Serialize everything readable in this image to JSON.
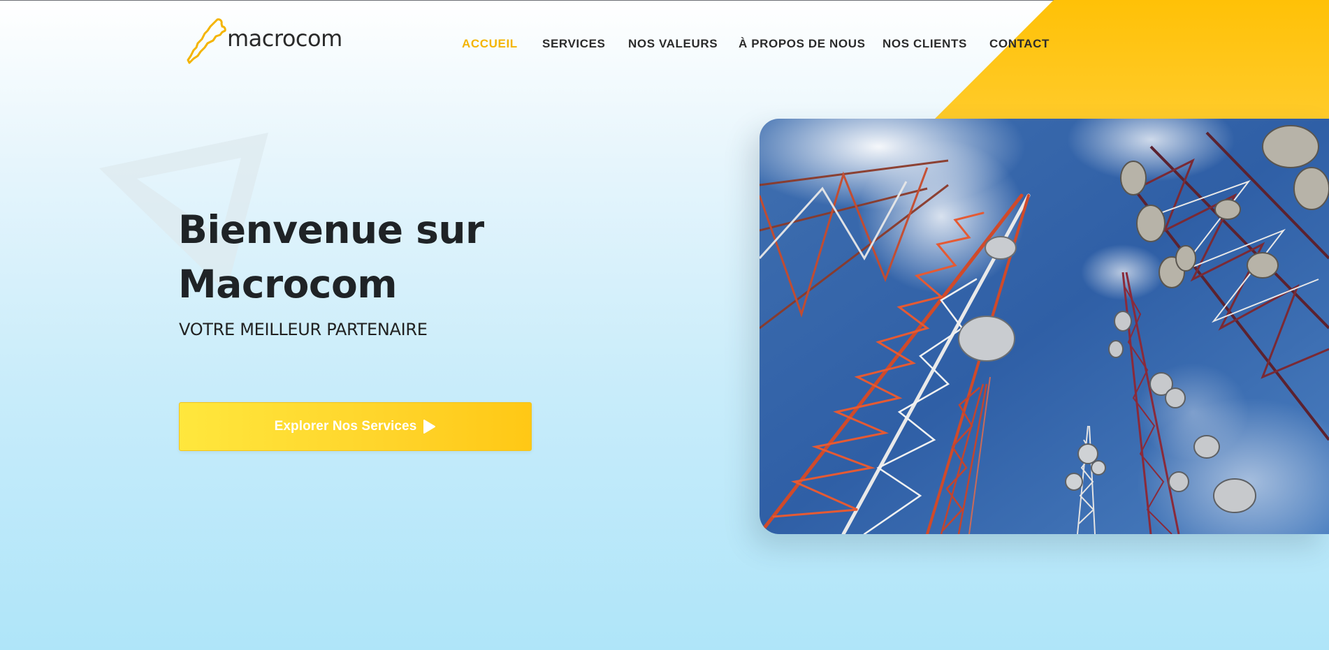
{
  "brand": {
    "name": "macrocom",
    "accent": "#f4b400",
    "cta_color": "#ffd42a"
  },
  "nav": {
    "items": [
      {
        "label": "ACCUEIL",
        "active": true
      },
      {
        "label": "SERVICES",
        "active": false
      },
      {
        "label": "NOS VALEURS",
        "active": false
      },
      {
        "label": "À PROPOS DE NOUS",
        "active": false
      },
      {
        "label": "NOS CLIENTS",
        "active": false
      },
      {
        "label": "CONTACT",
        "active": false
      }
    ]
  },
  "hero": {
    "title_line1": "Bienvenue sur",
    "title_line2": "Macrocom",
    "subtitle": "VOTRE MEILLEUR PARTENAIRE",
    "cta_label": "Explorer Nos Services",
    "cta_icon": "play-icon"
  },
  "hero_image": {
    "subject": "telecom-towers-photo"
  }
}
